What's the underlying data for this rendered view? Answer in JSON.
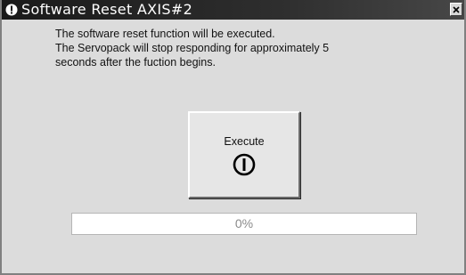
{
  "window": {
    "title": "Software Reset AXIS#2",
    "title_icon": "info-icon",
    "close_icon": "close-icon"
  },
  "message": {
    "lines": [
      "The software reset function will be executed.",
      "The Servopack will stop responding for approximately 5",
      "seconds after the fuction begins."
    ]
  },
  "execute_button": {
    "label": "Execute",
    "icon": "power-icon"
  },
  "progress": {
    "value": 0,
    "label": "0%"
  },
  "colors": {
    "title_bar": "#1a1a1a",
    "dialog_bg": "#dcdcdc",
    "progress_text": "#8a8a8a"
  }
}
